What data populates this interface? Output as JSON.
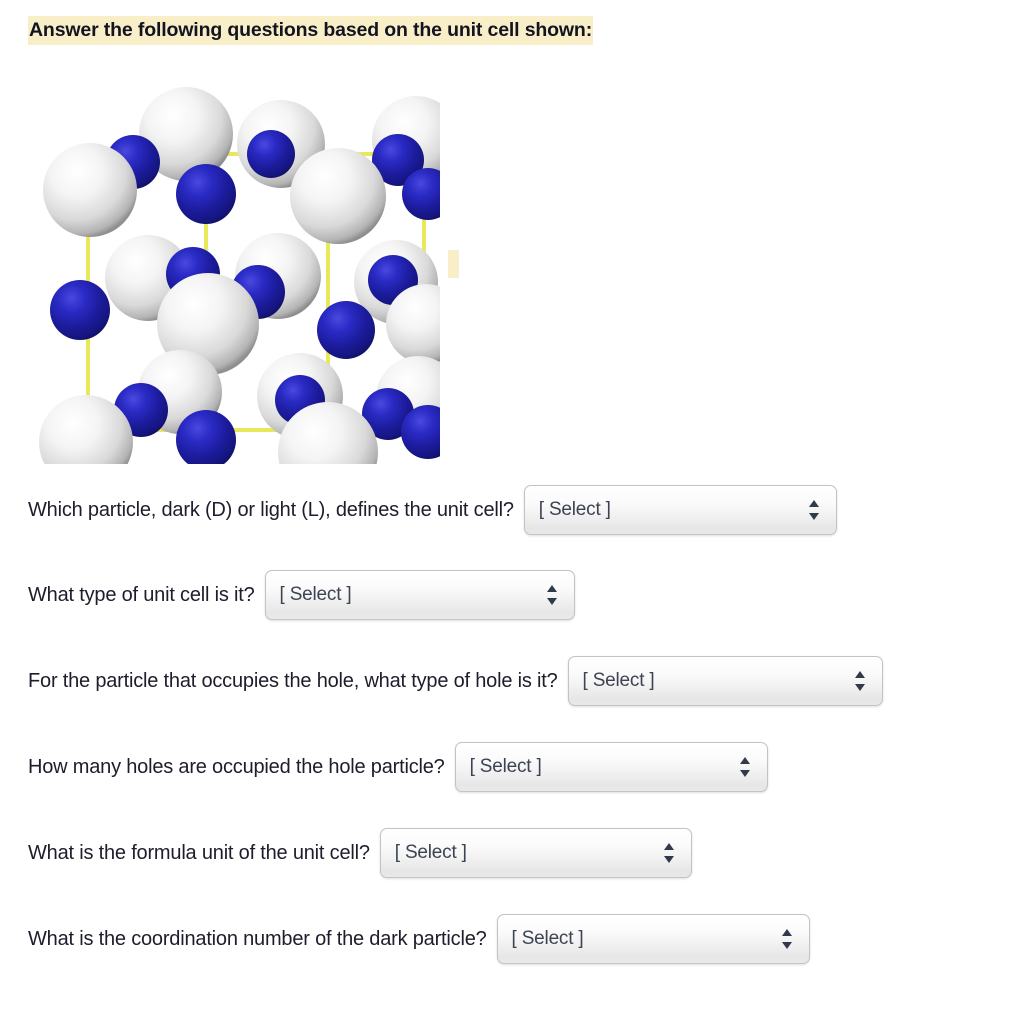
{
  "header": {
    "text": "Answer the following questions based on the unit cell shown:",
    "highlight_color": "#f8efc9"
  },
  "figure": {
    "name": "unit-cell-diagram",
    "description": "Three-dimensional ball-and-stick unit cell with large light (white/grey) spheres and smaller dark (blue) spheres connected by yellow cell-edge lines",
    "light_particle_color": "#f2f2f2",
    "dark_particle_color": "#1f1fa8",
    "edge_line_color": "#e8e85a"
  },
  "questions": [
    {
      "id": "defining-particle",
      "text": "Which particle, dark (D) or light (L), defines the unit cell?",
      "select_value": "[ Select ]"
    },
    {
      "id": "unit-cell-type",
      "text": "What type of unit cell is it?",
      "select_value": "[ Select ]"
    },
    {
      "id": "hole-type",
      "text": "For the particle that occupies the hole, what type of hole is it?",
      "select_value": "[ Select ]"
    },
    {
      "id": "holes-occupied",
      "text": "How many holes are occupied the hole particle?",
      "select_value": "[ Select ]"
    },
    {
      "id": "formula-unit",
      "text": "What is the formula unit of the unit cell?",
      "select_value": "[ Select ]"
    },
    {
      "id": "coordination-number",
      "text": "What is the coordination number of the dark particle?",
      "select_value": "[ Select ]"
    }
  ]
}
